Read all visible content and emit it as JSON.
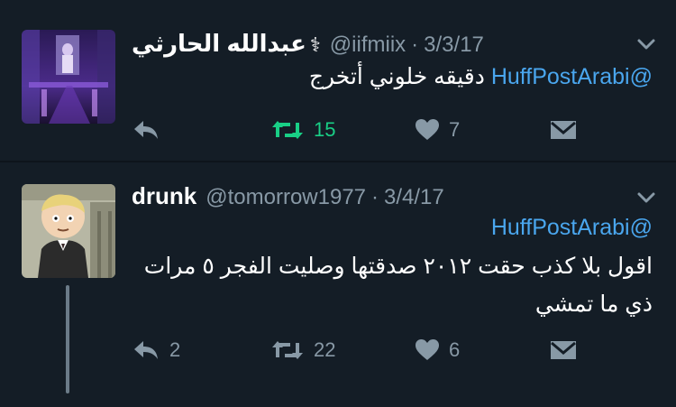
{
  "tweets": [
    {
      "name": "عبدالله الحارثي",
      "name_icon": "caduceus-icon",
      "handle": "@iifmiix",
      "date": "3/3/17",
      "mention": "@HuffPostArabi",
      "text_line1": "دقيقه خلوني أتخرج",
      "reply_count": "",
      "retweet_count": "15",
      "like_count": "7"
    },
    {
      "name": "drunk",
      "handle": "@tomorrow1977",
      "date": "3/4/17",
      "mention": "@HuffPostArabi",
      "text_line1": "اقول بلا كذب حقت ٢٠١٢ صدقتها وصليت الفجر ٥ مرات",
      "text_line2": "ذي ما تمشي",
      "reply_count": "2",
      "retweet_count": "22",
      "like_count": "6"
    }
  ],
  "separator_dot": "·",
  "colors": {
    "background": "#141d26",
    "mention": "#4aa6ee",
    "retweet_active": "#19cf86",
    "muted": "#8899a6"
  }
}
